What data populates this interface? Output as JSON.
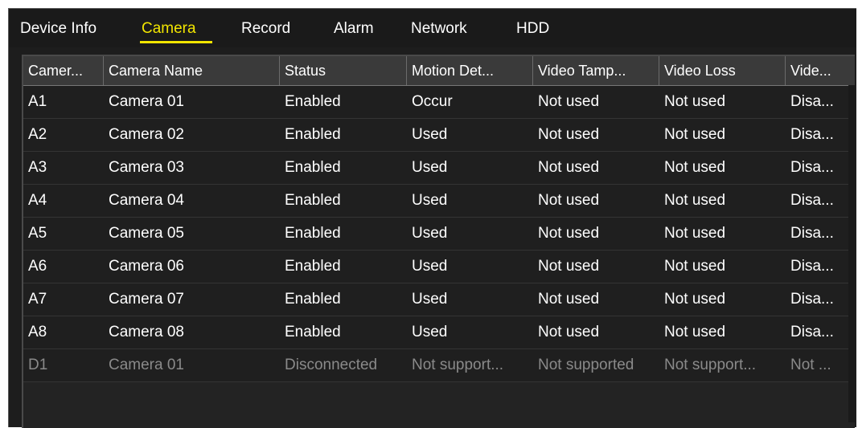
{
  "tabs": [
    {
      "label": "Device Info",
      "active": false
    },
    {
      "label": "Camera",
      "active": true
    },
    {
      "label": "Record",
      "active": false
    },
    {
      "label": "Alarm",
      "active": false
    },
    {
      "label": "Network",
      "active": false
    },
    {
      "label": "HDD",
      "active": false
    }
  ],
  "table": {
    "columns": [
      "Camer...",
      "Camera Name",
      "Status",
      "Motion Det...",
      "Video Tamp...",
      "Video Loss",
      "Vide..."
    ],
    "rows": [
      [
        "A1",
        "Camera 01",
        "Enabled",
        "Occur",
        "Not used",
        "Not used",
        "Disa..."
      ],
      [
        "A2",
        "Camera 02",
        "Enabled",
        "Used",
        "Not used",
        "Not used",
        "Disa..."
      ],
      [
        "A3",
        "Camera 03",
        "Enabled",
        "Used",
        "Not used",
        "Not used",
        "Disa..."
      ],
      [
        "A4",
        "Camera 04",
        "Enabled",
        "Used",
        "Not used",
        "Not used",
        "Disa..."
      ],
      [
        "A5",
        "Camera 05",
        "Enabled",
        "Used",
        "Not used",
        "Not used",
        "Disa..."
      ],
      [
        "A6",
        "Camera 06",
        "Enabled",
        "Used",
        "Not used",
        "Not used",
        "Disa..."
      ],
      [
        "A7",
        "Camera 07",
        "Enabled",
        "Used",
        "Not used",
        "Not used",
        "Disa..."
      ],
      [
        "A8",
        "Camera 08",
        "Enabled",
        "Used",
        "Not used",
        "Not used",
        "Disa..."
      ],
      [
        "D1",
        "Camera 01",
        "Disconnected",
        "Not support...",
        "Not supported",
        "Not support...",
        "Not ..."
      ]
    ],
    "dim_rows": [
      8
    ]
  },
  "colors": {
    "active_tab": "#f2e500",
    "background": "#1d1d1d",
    "disabled_text": "#8a8a8a"
  }
}
